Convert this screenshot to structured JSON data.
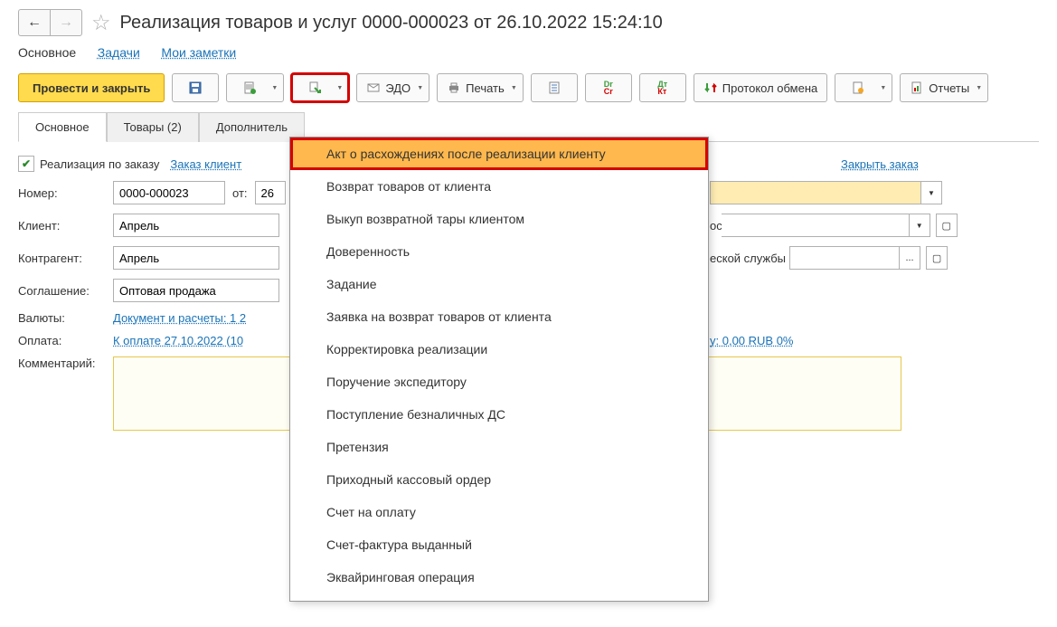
{
  "header": {
    "title": "Реализация товаров и услуг 0000-000023 от 26.10.2022 15:24:10"
  },
  "nav_links": {
    "main": "Основное",
    "tasks": "Задачи",
    "notes": "Мои заметки"
  },
  "toolbar": {
    "submit_close": "Провести и закрыть",
    "edo": "ЭДО",
    "print": "Печать",
    "protocol": "Протокол обмена",
    "reports": "Отчеты"
  },
  "tabs": {
    "main": "Основное",
    "goods": "Товары (2)",
    "additional": "Дополнитель"
  },
  "form": {
    "by_order_label": "Реализация по заказу",
    "order_link": "Заказ клиент",
    "close_order": "Закрыть заказ",
    "number_label": "Номер:",
    "number_value": "0000-000023",
    "from_label": "от:",
    "date_value": "26",
    "client_label": "Клиент:",
    "client_value": "Апрель",
    "warehouse_suffix": "ос",
    "counterparty_label": "Контрагент:",
    "counterparty_value": "Апрель",
    "service_suffix": "еской службы",
    "agreement_label": "Соглашение:",
    "agreement_value": "Оптовая продажа",
    "currency_label": "Валюты:",
    "currency_link": "Документ и расчеты: 1 2",
    "payment_label": "Оплата:",
    "payment_link": "К оплате 27.10.2022 (10",
    "payment_right": "у: 0,00 RUB 0%",
    "comment_label": "Комментарий:"
  },
  "dropdown": {
    "items": [
      "Акт о расхождениях после реализации клиенту",
      "Возврат товаров от клиента",
      "Выкуп возвратной тары клиентом",
      "Доверенность",
      "Задание",
      "Заявка на возврат товаров от клиента",
      "Корректировка реализации",
      "Поручение экспедитору",
      "Поступление безналичных ДС",
      "Претензия",
      "Приходный кассовый ордер",
      "Счет на оплату",
      "Счет-фактура выданный",
      "Эквайринговая операция"
    ]
  }
}
